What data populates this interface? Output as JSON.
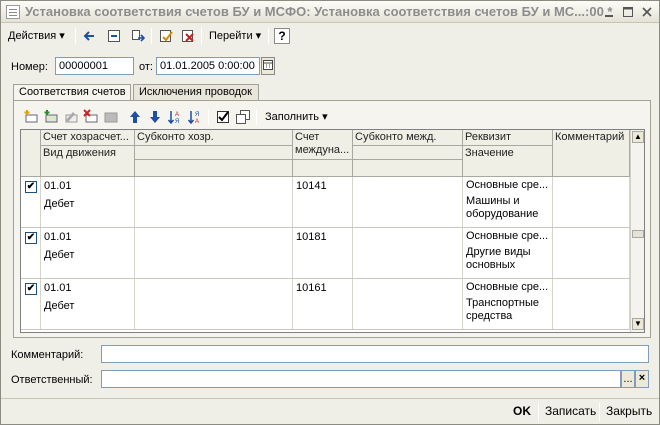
{
  "window": {
    "title": "Установка соответствия счетов БУ и МСФО: Установка соответствия счетов БУ и МС...:00 *",
    "minimize_icon": "minimize-icon",
    "maximize_icon": "maximize-icon",
    "close_icon": "close-icon"
  },
  "toolbar": {
    "actions_label": "Действия",
    "goto_label": "Перейти",
    "help_label": "?"
  },
  "form": {
    "number_label": "Номер:",
    "number_value": "00000001",
    "date_label": "от:",
    "date_value": "01.01.2005 0:00:00"
  },
  "tabs": [
    {
      "label": "Соответствия счетов"
    },
    {
      "label": "Исключения проводок"
    }
  ],
  "grid_toolbar": {
    "fill_label": "Заполнить"
  },
  "grid": {
    "headers": {
      "account_bu": "Счет хозрасчет...",
      "movement_type": "Вид движения",
      "subconto_bu": "Субконто хозр.",
      "account_ifrs_1": "Счет",
      "account_ifrs_2": "междуна...",
      "subconto_ifrs": "Субконто межд.",
      "attribute": "Реквизит",
      "value": "Значение",
      "comment": "Комментарий"
    },
    "rows": [
      {
        "checked": "✔",
        "account": "01.01",
        "movement": "Дебет",
        "ifrs_account": "10141",
        "attribute": "Основные сре...",
        "value": "Машины и оборудование"
      },
      {
        "checked": "✔",
        "account": "01.01",
        "movement": "Дебет",
        "ifrs_account": "10181",
        "attribute": "Основные сре...",
        "value": "Другие виды основных"
      },
      {
        "checked": "✔",
        "account": "01.01",
        "movement": "Дебет",
        "ifrs_account": "10161",
        "attribute": "Основные сре...",
        "value": "Транспортные средства"
      }
    ]
  },
  "footer_fields": {
    "comment_label": "Комментарий:",
    "comment_value": "",
    "responsible_label": "Ответственный:",
    "responsible_value": "",
    "select_button": "...",
    "clear_button": "×"
  },
  "buttons": {
    "ok": "OK",
    "save": "Записать",
    "close": "Закрыть"
  }
}
